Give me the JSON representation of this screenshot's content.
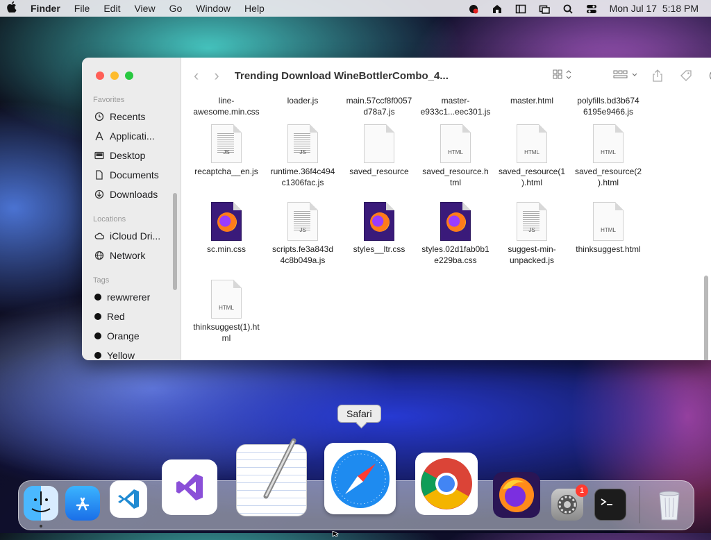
{
  "menubar": {
    "app": "Finder",
    "items": [
      "File",
      "Edit",
      "View",
      "Go",
      "Window",
      "Help"
    ],
    "datetime": "Mon Jul 17  5:18 PM"
  },
  "window": {
    "title": "Trending Download WineBottlerCombo_4...",
    "sidebar": {
      "favorites_header": "Favorites",
      "favorites": [
        "Recents",
        "Applicati...",
        "Desktop",
        "Documents",
        "Downloads"
      ],
      "locations_header": "Locations",
      "locations": [
        "iCloud Dri...",
        "Network"
      ],
      "tags_header": "Tags",
      "tags": [
        "rewwrerer",
        "Red",
        "Orange",
        "Yellow"
      ]
    },
    "files_row0": [
      "line-\nawesome.min.css",
      "loader.js",
      "main.57ccf8f0057\nd78a7.js",
      "master-\ne933c1...eec301.js",
      "master.html",
      "polyfills.bd3b674\n6195e9466.js"
    ],
    "files": [
      {
        "name": "recaptcha__en.js",
        "kind": "js",
        "badge": "JS"
      },
      {
        "name": "runtime.36f4c494\nc1306fac.js",
        "kind": "js",
        "badge": "JS"
      },
      {
        "name": "saved_resource",
        "kind": "blank",
        "badge": ""
      },
      {
        "name": "saved_resource.h\ntml",
        "kind": "html",
        "badge": "HTML"
      },
      {
        "name": "saved_resource(1\n).html",
        "kind": "html",
        "badge": "HTML"
      },
      {
        "name": "saved_resource(2\n).html",
        "kind": "html",
        "badge": "HTML"
      },
      {
        "name": "sc.min.css",
        "kind": "firefox",
        "badge": ""
      },
      {
        "name": "scripts.fe3a843d\n4c8b049a.js",
        "kind": "js",
        "badge": "JS"
      },
      {
        "name": "styles__ltr.css",
        "kind": "firefox",
        "badge": ""
      },
      {
        "name": "styles.02d1fab0b1\ne229ba.css",
        "kind": "firefox",
        "badge": ""
      },
      {
        "name": "suggest-min-\nunpacked.js",
        "kind": "js",
        "badge": "JS"
      },
      {
        "name": "thinksuggest.html",
        "kind": "html",
        "badge": "HTML"
      },
      {
        "name": "thinksuggest(1).ht\nml",
        "kind": "html",
        "badge": "HTML"
      }
    ]
  },
  "tooltip": "Safari",
  "dock": {
    "badge_count": "1"
  },
  "colors": {
    "close": "#ff5f57",
    "minimize": "#febc2e",
    "zoom": "#28c840"
  }
}
